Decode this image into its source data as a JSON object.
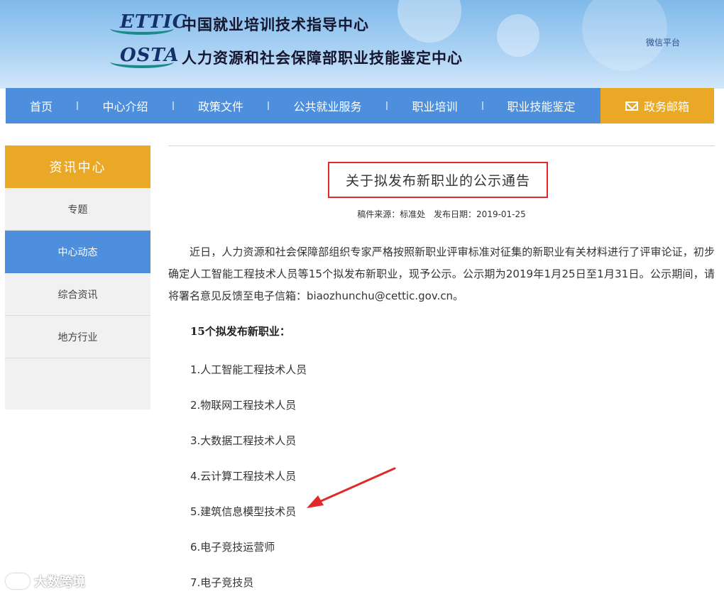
{
  "header": {
    "logo_ettic": "ETTIC",
    "org_name_1": "中国就业培训技术指导中心",
    "logo_osta": "OSTA",
    "org_name_2": "人力资源和社会保障部职业技能鉴定中心",
    "wechat_link": "微信平台"
  },
  "nav": {
    "items": [
      "首页",
      "中心介绍",
      "政策文件",
      "公共就业服务",
      "职业培训",
      "职业技能鉴定"
    ],
    "mail_label": "政务邮箱"
  },
  "sidebar": {
    "title": "资讯中心",
    "items": [
      "专题",
      "中心动态",
      "综合资讯",
      "地方行业"
    ],
    "active_index": 1
  },
  "article": {
    "title": "关于拟发布新职业的公示通告",
    "source_label": "稿件来源：标准处",
    "date_label": "发布日期：2019-01-25",
    "body": "近日，人力资源和社会保障部组织专家严格按照新职业评审标准对征集的新职业有关材料进行了评审论证，初步确定人工智能工程技术人员等15个拟发布新职业，现予公示。公示期为2019年1月25日至1月31日。公示期间，请将署名意见反馈至电子信箱：biaozhunchu@cettic.gov.cn。",
    "list_heading": "15个拟发布新职业：",
    "list": [
      "1.人工智能工程技术人员",
      "2.物联网工程技术人员",
      "3.大数据工程技术人员",
      "4.云计算工程技术人员",
      "5.建筑信息模型技术员",
      "6.电子竞技运营师",
      "7.电子竞技员"
    ]
  },
  "watermark": "大数跨境",
  "colors": {
    "nav_blue": "#4d8fdc",
    "accent_orange": "#e9a926",
    "highlight_red": "#e02a2a"
  }
}
